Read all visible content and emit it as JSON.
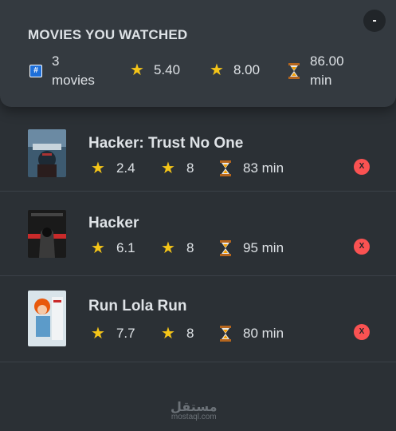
{
  "summary": {
    "title": "MOVIES YOU WATCHED",
    "toggle_label": "-",
    "movies_count": "3",
    "movies_unit": "movies",
    "avg_imdb_rating": "5.40",
    "avg_user_rating": "8.00",
    "avg_runtime": "86.00",
    "runtime_unit": "min",
    "icons": {
      "count": "hash-icon",
      "rating": "star-icon",
      "runtime": "hourglass-icon"
    }
  },
  "movies": [
    {
      "title": "Hacker: Trust No One",
      "imdb_rating": "2.4",
      "user_rating": "8",
      "runtime": "83 min",
      "delete_label": "X"
    },
    {
      "title": "Hacker",
      "imdb_rating": "6.1",
      "user_rating": "8",
      "runtime": "95 min",
      "delete_label": "X"
    },
    {
      "title": "Run Lola Run",
      "imdb_rating": "7.7",
      "user_rating": "8",
      "runtime": "80 min",
      "delete_label": "X"
    }
  ],
  "watermark": {
    "arabic": "مستقل",
    "latin": "mostaql.com"
  },
  "colors": {
    "background": "#2b3035",
    "summary_bg": "#343a40",
    "star": "#f5c518",
    "delete": "#fa5252",
    "hash": "#1e6fd9"
  }
}
